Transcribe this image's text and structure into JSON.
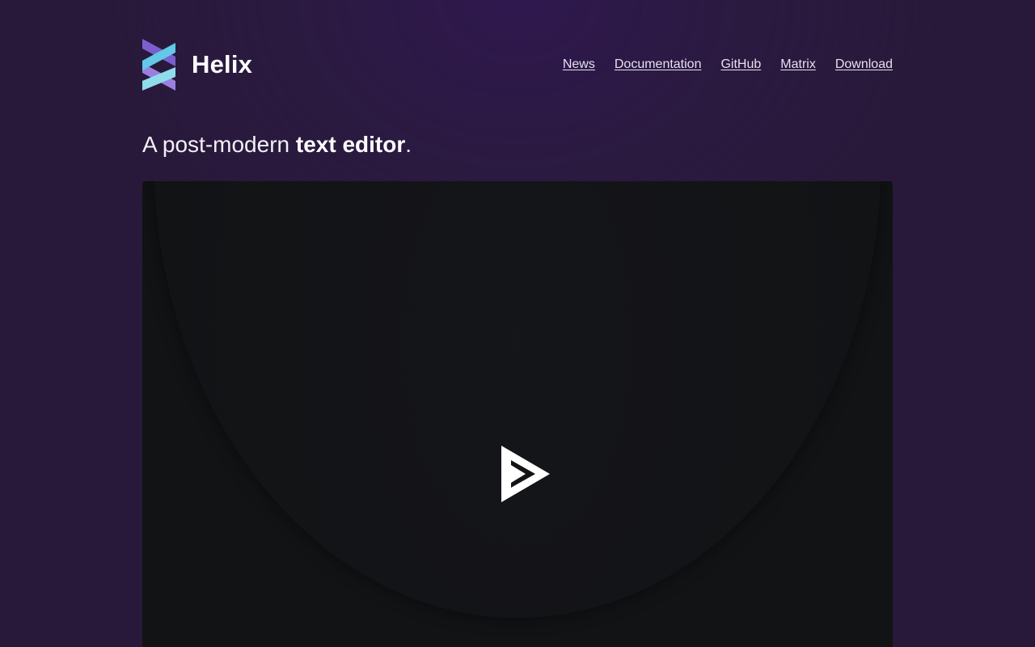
{
  "brand": {
    "name": "Helix",
    "logo_icon": "helix-logo-icon"
  },
  "nav": {
    "items": [
      {
        "label": "News"
      },
      {
        "label": "Documentation"
      },
      {
        "label": "GitHub"
      },
      {
        "label": "Matrix"
      },
      {
        "label": "Download"
      }
    ]
  },
  "hero": {
    "tagline_prefix": "A post-modern ",
    "tagline_bold": "text editor",
    "tagline_suffix": "."
  },
  "player": {
    "play_icon": "asciinema-play-icon"
  },
  "colors": {
    "page_background": "#28193a",
    "player_background": "#121315",
    "logo_purple": "#8a6fd6",
    "logo_cyan": "#78d4e8"
  }
}
